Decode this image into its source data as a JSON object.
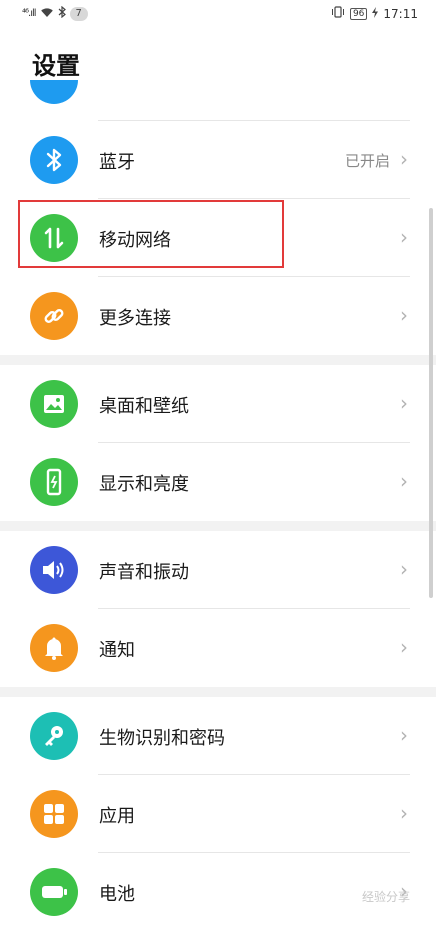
{
  "status_bar": {
    "signal": "⁴⁶.ıll",
    "notification_count": "7",
    "battery": "96",
    "time": "17:11"
  },
  "page": {
    "title": "设置"
  },
  "rows": [
    {
      "label": "蓝牙",
      "value": "已开启",
      "icon": "bluetooth-icon",
      "color": "#1E9BF0"
    },
    {
      "label": "移动网络",
      "value": "",
      "icon": "mobile-network-icon",
      "color": "#3DC248"
    },
    {
      "label": "更多连接",
      "value": "",
      "icon": "link-icon",
      "color": "#F5961E"
    },
    {
      "label": "桌面和壁纸",
      "value": "",
      "icon": "wallpaper-icon",
      "color": "#3DC248"
    },
    {
      "label": "显示和亮度",
      "value": "",
      "icon": "display-icon",
      "color": "#3DC248"
    },
    {
      "label": "声音和振动",
      "value": "",
      "icon": "speaker-icon",
      "color": "#3D57D8"
    },
    {
      "label": "通知",
      "value": "",
      "icon": "bell-icon",
      "color": "#F5961E"
    },
    {
      "label": "生物识别和密码",
      "value": "",
      "icon": "key-icon",
      "color": "#1DBFB4"
    },
    {
      "label": "应用",
      "value": "",
      "icon": "apps-grid-icon",
      "color": "#F5961E"
    },
    {
      "label": "电池",
      "value": "",
      "icon": "battery-icon",
      "color": "#3DC248"
    }
  ],
  "watermark": "经验分享"
}
